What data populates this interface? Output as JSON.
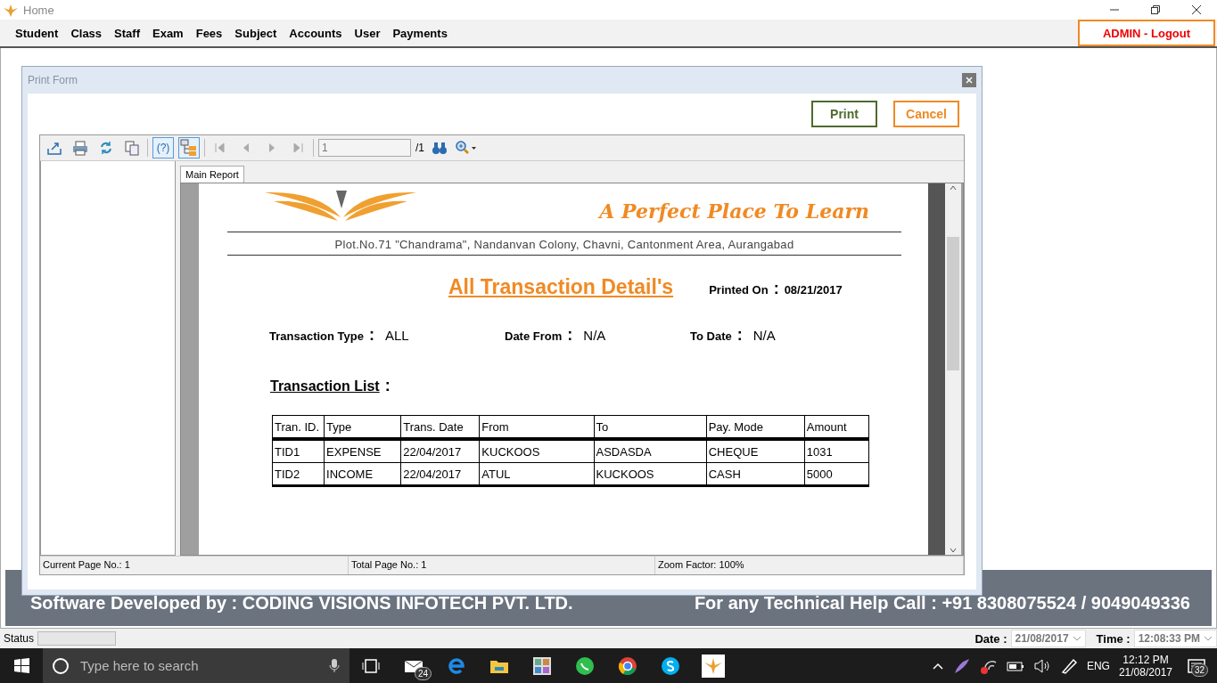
{
  "window": {
    "title": "Home"
  },
  "menu": [
    "Student",
    "Class",
    "Staff",
    "Exam",
    "Fees",
    "Subject",
    "Accounts",
    "User",
    "Payments"
  ],
  "logout_button": "ADMIN - Logout",
  "dialog": {
    "title": "Print Form",
    "buttons": [
      {
        "label": "Print",
        "kind": "print"
      },
      {
        "label": "Cancel",
        "kind": "cancel"
      }
    ],
    "viewer": {
      "help_button": "(?)",
      "page_field": "1",
      "page_total": "/1",
      "tab": "Main Report",
      "status": [
        "Current Page No.: 1",
        "Total Page No.: 1",
        "Zoom Factor: 100%"
      ]
    },
    "report": {
      "tagline": "A Perfect Place To Learn",
      "address": "Plot.No.71 \"Chandrama\", Nandanvan Colony, Chavni, Cantonment Area, Aurangabad",
      "title": "All Transaction Detail's",
      "printed_on_label": "Printed On",
      "separator": ":",
      "printed_on": "08/21/2017",
      "filters": [
        {
          "label": "Transaction Type",
          "value": "ALL"
        },
        {
          "label": "Date From",
          "value": "N/A"
        },
        {
          "label": "To Date",
          "value": "N/A"
        }
      ],
      "list_title": "Transaction List",
      "columns": [
        "Tran. ID.",
        "Type",
        "Trans. Date",
        "From",
        "To",
        "Pay. Mode",
        "Amount"
      ],
      "rows": [
        [
          "TID1",
          "EXPENSE",
          "22/04/2017",
          "KUCKOOS",
          "ASDASDA",
          "CHEQUE",
          "1031"
        ],
        [
          "TID2",
          "INCOME",
          "22/04/2017",
          "ATUL",
          "KUCKOOS",
          "CASH",
          "5000"
        ]
      ]
    }
  },
  "banner": {
    "left": "Software Developed by : CODING VISIONS INFOTECH PVT. LTD.",
    "right": "For any Technical Help Call : +91 8308075524 / 9049049336"
  },
  "status_bar": {
    "label": "Status",
    "progress": {
      "level": 0
    },
    "date_label": "Date :",
    "date": "21/08/2017",
    "time_label": "Time :",
    "time": "12:08:33 PM"
  },
  "taskbar": {
    "search_placeholder": "Type here to search",
    "mail_badge": "24",
    "language": "ENG",
    "clock_time": "12:12 PM",
    "clock_date": "21/08/2017",
    "notification_badge": "32"
  }
}
